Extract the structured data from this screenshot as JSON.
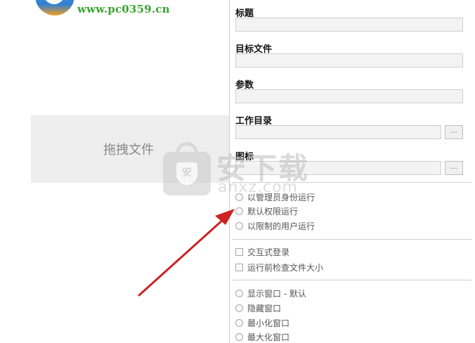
{
  "site": {
    "url": "www.pc0359.cn"
  },
  "drop_zone": {
    "label": "拖拽文件"
  },
  "form": {
    "title_label": "标题",
    "target_label": "目标文件",
    "args_label": "参数",
    "workdir_label": "工作目录",
    "icon_label": "图标",
    "browse_label": "..."
  },
  "run_as": {
    "options": [
      "以管理员身份运行",
      "默认权限运行",
      "以限制的用户运行"
    ]
  },
  "checks": {
    "options": [
      "交互式登录",
      "运行前检查文件大小"
    ]
  },
  "window_state": {
    "options": [
      "显示窗口 - 默认",
      "隐藏窗口",
      "最小化窗口",
      "最大化窗口"
    ]
  },
  "watermark": {
    "main": "安下载",
    "sub": "anxz.com",
    "badge": "安"
  },
  "colors": {
    "arrow": "#cc2222",
    "url": "#39a52f"
  }
}
